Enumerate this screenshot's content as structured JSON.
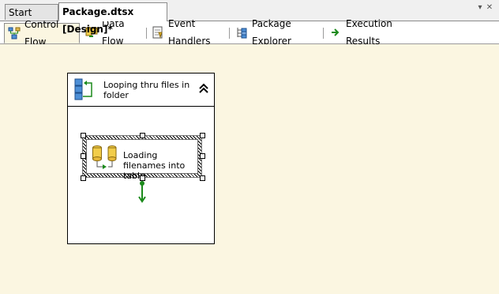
{
  "doc_tabs": [
    {
      "label": "Start Page"
    },
    {
      "label": "Package.dtsx [Design]*"
    }
  ],
  "designer_tabs": [
    {
      "label": "Control Flow",
      "icon": "control-flow-icon"
    },
    {
      "label": "Data Flow",
      "icon": "data-flow-icon"
    },
    {
      "label": "Event Handlers",
      "icon": "event-handlers-icon"
    },
    {
      "label": "Package Explorer",
      "icon": "package-explorer-icon"
    },
    {
      "label": "Execution Results",
      "icon": "execution-results-icon"
    }
  ],
  "canvas": {
    "container_title": "Looping thru files in folder",
    "task_title": "Loading filenames into table"
  },
  "colors": {
    "canvas_bg": "#fbf6e1",
    "precedence_green": "#007a00"
  }
}
